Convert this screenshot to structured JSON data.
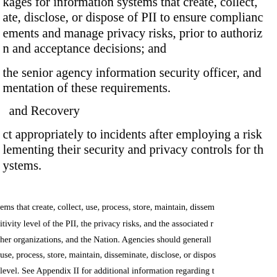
{
  "document": {
    "body_lines": [
      "kages for information systems that create, collect,",
      "ate, disclose, or dispose of PII to ensure complianc",
      "ements and manage privacy risks, prior to authoriz",
      "n and acceptance decisions; and",
      "the senior agency information security officer, and",
      "mentation of these requirements.",
      "and Recovery",
      "ct appropriately to incidents after employing a risk",
      "lementing their security and privacy controls for th",
      "ystems."
    ],
    "footnote_lines": [
      "ems that create, collect, use, process, store, maintain, dissem",
      "itivity level of the PII, the privacy risks, and the associated r",
      "her organizations, and the Nation.  Agencies should generall",
      "use, process, store, maintain, disseminate, disclose, or dispos",
      "level. See Appendix II for additional information regarding t"
    ]
  }
}
